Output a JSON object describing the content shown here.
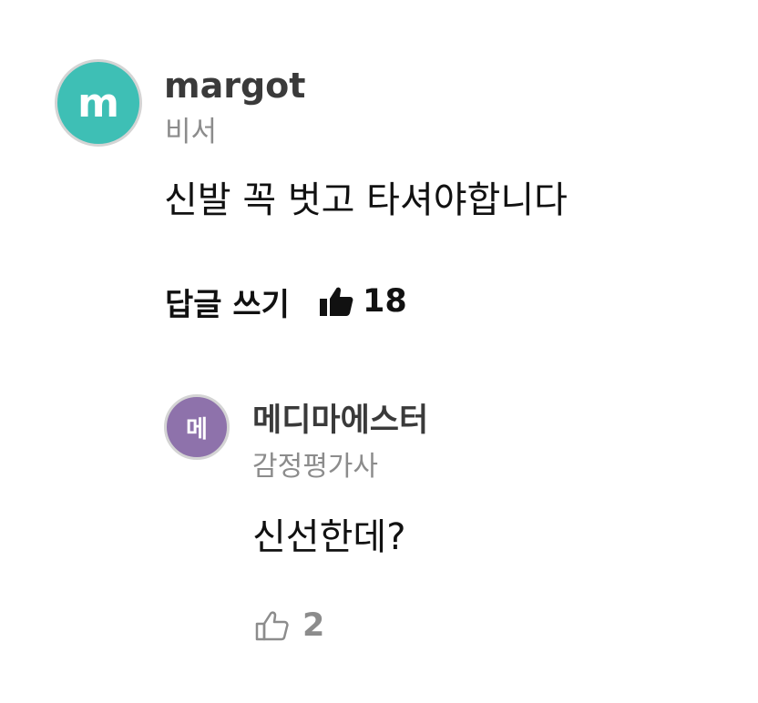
{
  "comment": {
    "avatar_letter": "m",
    "avatar_color": "#3ebfb5",
    "author": "margot",
    "role": "비서",
    "text": "신발 꼭 벗고 타셔야합니다",
    "reply_label": "답글 쓰기",
    "like_icon": "thumbs-up-filled-icon",
    "likes": "18"
  },
  "reply": {
    "avatar_letter": "메",
    "avatar_color": "#8e72ab",
    "author": "메디마에스터",
    "role": "감정평가사",
    "text": "신선한데?",
    "like_icon": "thumbs-up-outline-icon",
    "likes": "2"
  }
}
